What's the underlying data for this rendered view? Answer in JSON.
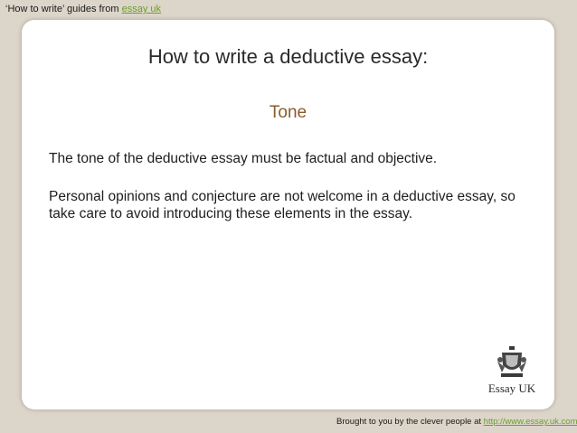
{
  "header": {
    "prefix": "‘How to write’ guides from ",
    "link": "essay uk"
  },
  "slide": {
    "title": "How to write a deductive essay:",
    "section": "Tone",
    "paragraphs": [
      "The tone of the deductive essay must be factual and objective.",
      "Personal opinions and conjecture are not welcome in a deductive essay, so take care to avoid introducing these elements in the essay."
    ],
    "logo_text": "Essay UK"
  },
  "footer": {
    "prefix": "Brought to you by the clever people at ",
    "link": "http://www.essay.uk.com"
  },
  "colors": {
    "background": "#dcd5c9",
    "link": "#6aa12a",
    "section_heading": "#8b5a2b"
  },
  "icons": [
    "crest-icon"
  ]
}
